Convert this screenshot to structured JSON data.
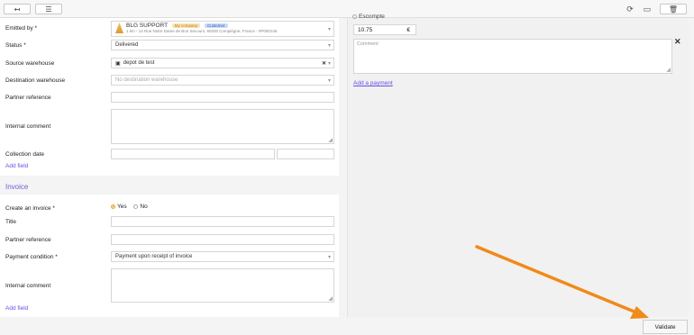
{
  "toolbar": {
    "back_icon": "back-arrow-icon",
    "list_icon": "list-icon",
    "refresh_icon": "refresh-icon",
    "screen_icon": "monitor-icon",
    "delete_icon": "trash-icon"
  },
  "form": {
    "emitted_by": {
      "label": "Emitted by *",
      "name": "BLG SUPPORT",
      "tags": [
        "My company",
        "Customer"
      ],
      "address": "1 km - 14 Rue Notre Dame de Bon Secours, 60200 Compiègne, France - #P000146"
    },
    "status": {
      "label": "Status *",
      "value": "Delivered"
    },
    "source_warehouse": {
      "label": "Source warehouse",
      "value": "depot de test"
    },
    "destination_warehouse": {
      "label": "Destination warehouse",
      "placeholder": "No destination warehouse"
    },
    "partner_reference": {
      "label": "Partner reference",
      "value": ""
    },
    "internal_comment": {
      "label": "Internal comment",
      "value": ""
    },
    "collection_date": {
      "label": "Collection date"
    },
    "add_field": "Add field"
  },
  "invoice": {
    "section_title": "Invoice",
    "create_invoice": {
      "label": "Create an invoice *",
      "yes": "Yes",
      "no": "No"
    },
    "title": {
      "label": "Title"
    },
    "partner_reference": {
      "label": "Partner reference"
    },
    "payment_condition": {
      "label": "Payment condition *",
      "value": "Payment upon receipt of invoice"
    },
    "internal_comment": {
      "label": "Internal comment"
    },
    "add_field": "Add field"
  },
  "payment": {
    "method": "Escompte",
    "amount": "10.75",
    "currency": "€",
    "comment_placeholder": "Comment",
    "add_payment": "Add a payment"
  },
  "footer": {
    "validate": "Validate"
  },
  "colors": {
    "accent": "#6d4de8",
    "arrow": "#f08a1a"
  }
}
